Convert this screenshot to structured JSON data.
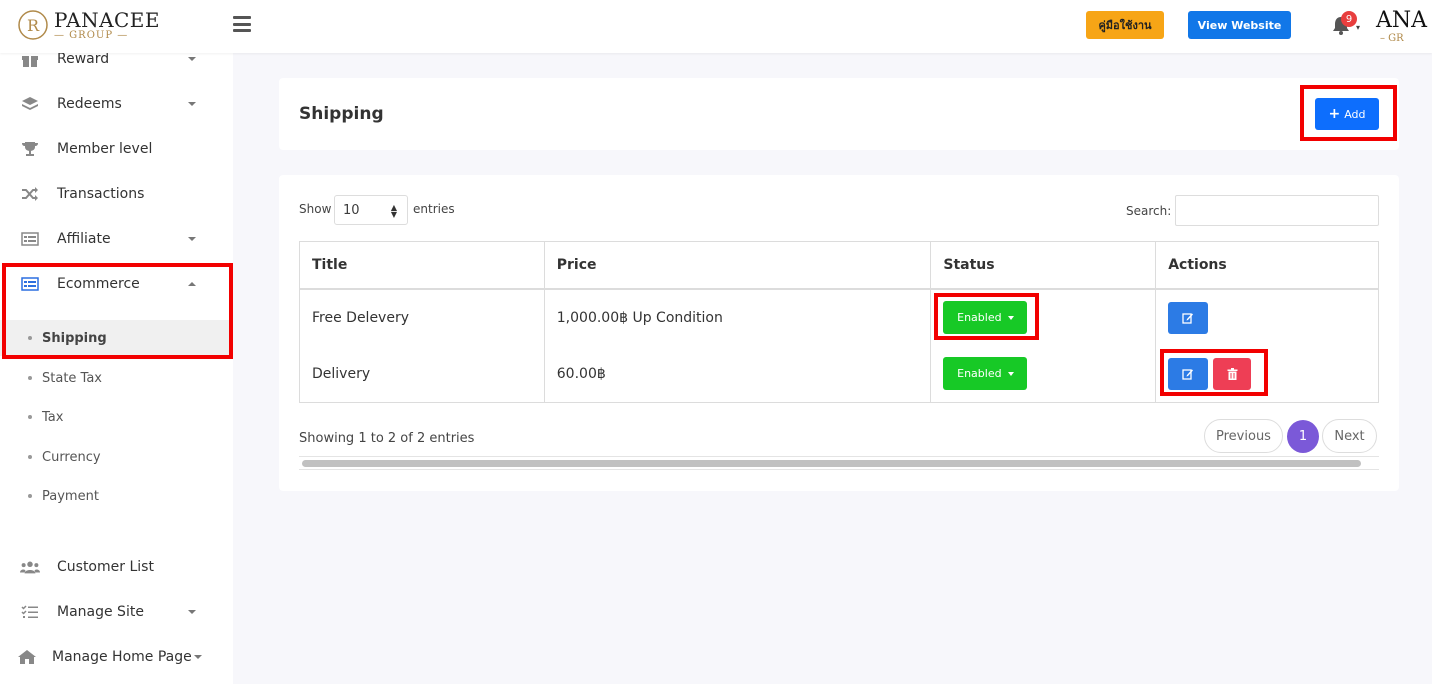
{
  "header": {
    "logo_text": "PANACEE",
    "logo_sub": "— GROUP —",
    "manual_label": "คู่มือใช้งาน",
    "view_website_label": "View Website",
    "notification_count": "9",
    "brand_right": "ANA",
    "brand_right_sub": "– GR"
  },
  "sidebar": {
    "items": [
      {
        "label": "Reward",
        "icon": "gift-icon"
      },
      {
        "label": "Redeems",
        "icon": "layers-icon"
      },
      {
        "label": "Member level",
        "icon": "trophy-icon"
      },
      {
        "label": "Transactions",
        "icon": "shuffle-icon"
      },
      {
        "label": "Affiliate",
        "icon": "list-icon"
      },
      {
        "label": "Ecommerce",
        "icon": "list-icon"
      }
    ],
    "submenu": [
      {
        "label": "Shipping"
      },
      {
        "label": "State Tax"
      },
      {
        "label": "Tax"
      },
      {
        "label": "Currency"
      },
      {
        "label": "Payment"
      }
    ],
    "bottom_items": [
      {
        "label": "Customer List",
        "icon": "users-icon"
      },
      {
        "label": "Manage Site",
        "icon": "tasks-icon"
      },
      {
        "label": "Manage Home Page",
        "icon": "home-icon"
      }
    ]
  },
  "main": {
    "title": "Shipping",
    "add_label": "Add",
    "show_label": "Show",
    "entries_value": "10",
    "entries_label": "entries",
    "search_label": "Search:",
    "columns": [
      "Title",
      "Price",
      "Status",
      "Actions"
    ],
    "rows": [
      {
        "title": "Free Delevery",
        "price": "1,000.00฿ Up Condition",
        "status": "Enabled"
      },
      {
        "title": "Delivery",
        "price": "60.00฿",
        "status": "Enabled"
      }
    ],
    "showing_text": "Showing 1 to 2 of 2 entries",
    "pagination": {
      "previous": "Previous",
      "page": "1",
      "next": "Next"
    }
  },
  "colors": {
    "accent": "#0d6efd",
    "enabled": "#17c926",
    "delete": "#ee3e55",
    "highlight": "#f20000",
    "active_page": "#7b59d8"
  }
}
